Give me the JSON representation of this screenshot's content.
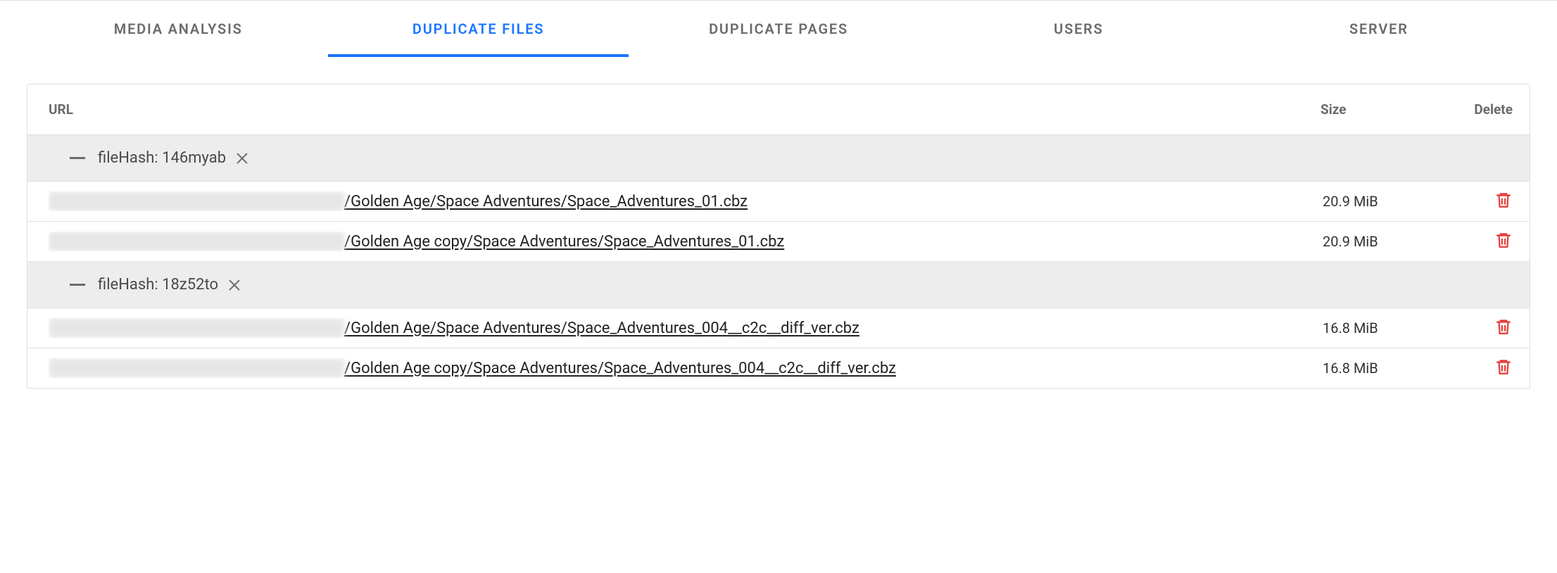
{
  "tabs": [
    {
      "id": "media-analysis",
      "label": "MEDIA ANALYSIS",
      "active": false
    },
    {
      "id": "duplicate-files",
      "label": "DUPLICATE FILES",
      "active": true
    },
    {
      "id": "duplicate-pages",
      "label": "DUPLICATE PAGES",
      "active": false
    },
    {
      "id": "users",
      "label": "USERS",
      "active": false
    },
    {
      "id": "server",
      "label": "SERVER",
      "active": false
    }
  ],
  "columns": {
    "url": "URL",
    "size": "Size",
    "delete": "Delete"
  },
  "groups": [
    {
      "label": "fileHash: 146myab",
      "files": [
        {
          "path": "/Golden Age/Space Adventures/Space_Adventures_01.cbz",
          "size": "20.9 MiB"
        },
        {
          "path": "/Golden Age copy/Space Adventures/Space_Adventures_01.cbz",
          "size": "20.9 MiB"
        }
      ]
    },
    {
      "label": "fileHash: 18z52to",
      "files": [
        {
          "path": "/Golden Age/Space Adventures/Space_Adventures_004__c2c__diff_ver.cbz",
          "size": "16.8 MiB"
        },
        {
          "path": "/Golden Age copy/Space Adventures/Space_Adventures_004__c2c__diff_ver.cbz",
          "size": "16.8 MiB"
        }
      ]
    }
  ]
}
